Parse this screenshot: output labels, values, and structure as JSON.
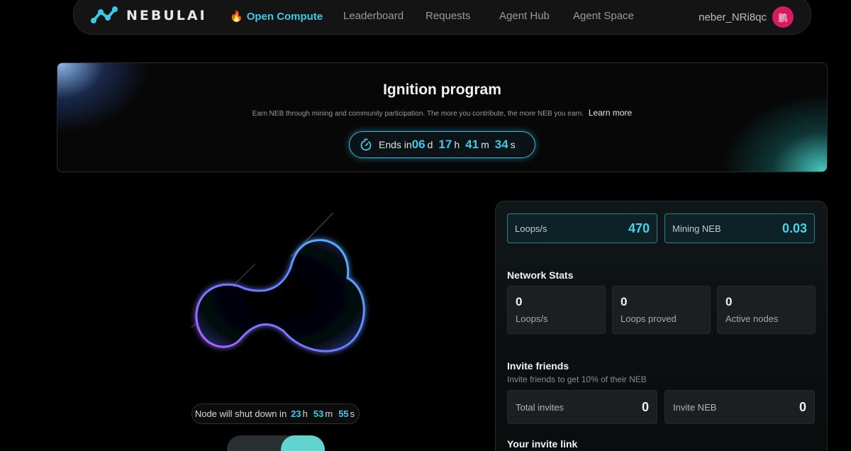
{
  "nav": {
    "brand": "NEBULAI",
    "items": [
      {
        "label": "Open Compute",
        "active": true,
        "icon": "fire-icon"
      },
      {
        "label": "Leaderboard"
      },
      {
        "label": "Requests"
      },
      {
        "label": "Agent Hub"
      },
      {
        "label": "Agent Space"
      }
    ],
    "user": {
      "name": "neber_NRi8qc",
      "avatar_char": "鹏",
      "avatar_color": "#d81b60"
    }
  },
  "banner": {
    "title": "Ignition program",
    "subtitle": "Earn NEB through mining and community participation. The more you contribute, the more NEB you earn.",
    "learn_more": "Learn more",
    "countdown": {
      "label": "Ends in",
      "days": "06",
      "days_unit": "d",
      "hours": "17",
      "hours_unit": "h",
      "minutes": "41",
      "minutes_unit": "m",
      "seconds": "34",
      "seconds_unit": "s"
    }
  },
  "node": {
    "shutdown_label": "Node will shut down in",
    "hours": "23",
    "hours_unit": "h",
    "minutes": "53",
    "minutes_unit": "m",
    "seconds": "55",
    "seconds_unit": "s"
  },
  "panel": {
    "top_stats": [
      {
        "label": "Loops/s",
        "value": "470"
      },
      {
        "label": "Mining NEB",
        "value": "0.03"
      }
    ],
    "network_title": "Network Stats",
    "network_stats": [
      {
        "value": "0",
        "label": "Loops/s"
      },
      {
        "value": "0",
        "label": "Loops proved"
      },
      {
        "value": "0",
        "label": "Active nodes"
      }
    ],
    "invite_title": "Invite friends",
    "invite_subtitle": "Invite friends to get 10% of their NEB",
    "invite_stats": [
      {
        "label": "Total invites",
        "value": "0"
      },
      {
        "label": "Invite NEB",
        "value": "0"
      }
    ],
    "invite_link_title": "Your invite link"
  },
  "colors": {
    "accent": "#3ec8e8",
    "background": "#000000"
  }
}
